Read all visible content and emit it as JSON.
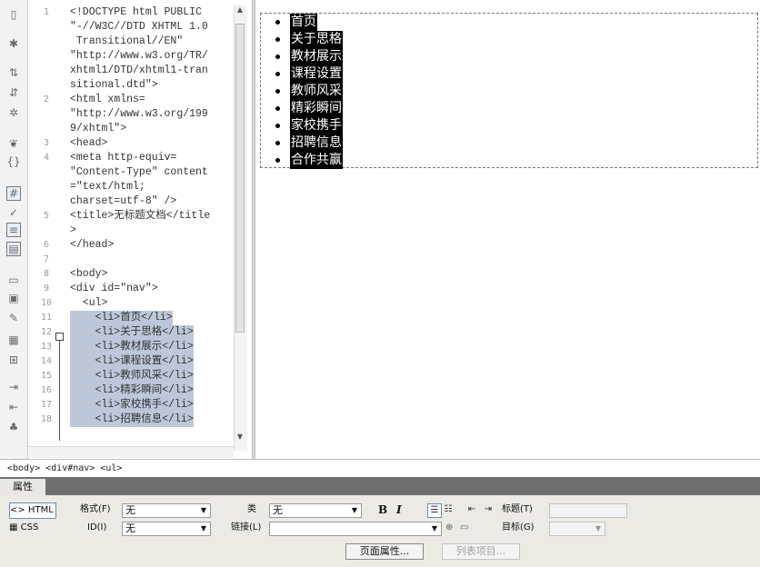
{
  "toolbar_icons": [
    "open-documents-icon",
    "show-code-navigator-icon",
    "collapse-full-tag-icon",
    "collapse-selection-icon",
    "expand-all-icon",
    "select-parent-tag-icon",
    "balance-braces-icon",
    "line-numbers-icon",
    "highlight-invalid-code-icon",
    "word-wrap-icon",
    "syntax-coloring-icon",
    "apply-comment-icon",
    "remove-comment-icon",
    "wrap-tag-icon",
    "recent-snippets-icon",
    "move-css-icon",
    "indent-code-icon",
    "outdent-code-icon",
    "format-source-code-icon"
  ],
  "code": {
    "line_numbers": [
      "1",
      "2",
      "3",
      "4",
      "5",
      "6",
      "7",
      "8",
      "9",
      "10",
      "11",
      "12",
      "13",
      "14",
      "15",
      "16",
      "17",
      "18"
    ],
    "lines": [
      "<!DOCTYPE html PUBLIC",
      "\"-//W3C//DTD XHTML 1.0",
      " Transitional//EN\"",
      "\"http://www.w3.org/TR/",
      "xhtml1/DTD/xhtml1-tran",
      "sitional.dtd\">",
      "<html xmlns=",
      "\"http://www.w3.org/199",
      "9/xhtml\">",
      "<head>",
      "<meta http-equiv=",
      "\"Content-Type\" content",
      "=\"text/html;",
      "charset=utf-8\" />",
      "<title>无标题文档</title",
      ">",
      "</head>",
      "",
      "<body>",
      "<div id=\"nav\">",
      "  <ul>",
      "    <li>首页</li>",
      "    <li>关于思格</li>",
      "    <li>教材展示</li>",
      "    <li>课程设置</li>",
      "    <li>教师风采</li>",
      "    <li>精彩瞬间</li>",
      "    <li>家校携手</li>",
      "    <li>招聘信息</li>"
    ]
  },
  "design": {
    "nav_items": [
      "首页",
      "关于思格",
      "教材展示",
      "课程设置",
      "教师风采",
      "精彩瞬间",
      "家校携手",
      "招聘信息",
      "合作共赢"
    ]
  },
  "tag_selector": "<body> <div#nav> <ul>",
  "properties": {
    "title": "属性",
    "html_tab": "<> HTML",
    "css_tab": "CSS",
    "format_label": "格式(F)",
    "format_value": "无",
    "id_label": "ID(I)",
    "id_value": "无",
    "class_label": "类",
    "class_value": "无",
    "link_label": "链接(L)",
    "link_value": "",
    "bold": "B",
    "italic": "I",
    "title_label": "标题(T)",
    "target_label": "目标(G)",
    "page_props_button": "页面属性...",
    "list_item_button": "列表项目..."
  }
}
